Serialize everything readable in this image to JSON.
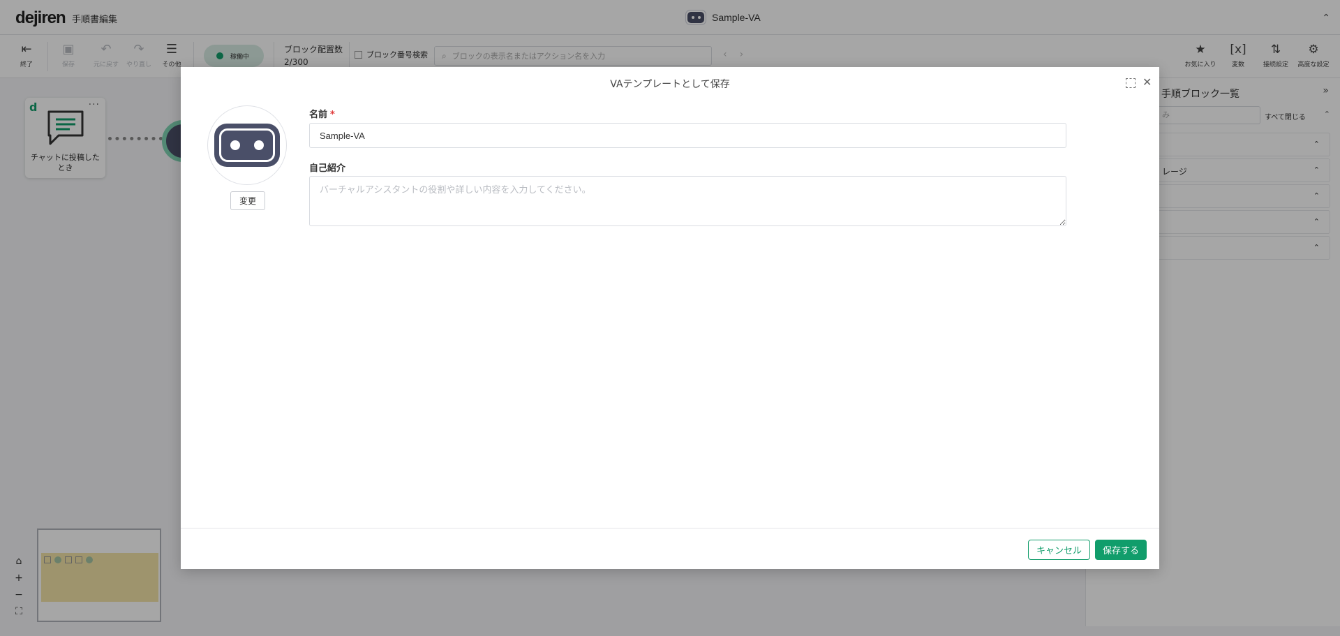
{
  "header": {
    "logo": "dejiren",
    "title": "手順書編集",
    "va_name": "Sample-VA"
  },
  "toolbar": {
    "exit_label": "終了",
    "save_label": "保存",
    "undo_label": "元に戻す",
    "redo_label": "やり直し",
    "other_label": "その他",
    "status_label": "稼働中",
    "block_count_label": "ブロック配置数",
    "block_count_value": "2/300",
    "block_number_search_label": "ブロック番号検索",
    "search_placeholder": "ブロックの表示名またはアクション名を入力",
    "favorites_label": "お気に入り",
    "variables_label": "変数",
    "connection_settings_label": "接続設定",
    "advanced_settings_label": "高度な設定"
  },
  "canvas": {
    "trigger_card_label": "チャットに投稿したとき"
  },
  "right_panel": {
    "title": "手順ブロック一覧",
    "filter_text": "み",
    "close_all_label": "すべて閉じる",
    "rows": [
      {
        "label": ""
      },
      {
        "label": "レージ"
      },
      {
        "label": ""
      },
      {
        "label": ""
      },
      {
        "label": ""
      }
    ]
  },
  "modal": {
    "title": "VAテンプレートとして保存",
    "change_label": "変更",
    "name_label": "名前",
    "required_mark": "*",
    "name_value": "Sample-VA",
    "intro_label": "自己紹介",
    "intro_placeholder": "バーチャルアシスタントの役割や詳しい内容を入力してください。",
    "cancel_label": "キャンセル",
    "save_label": "保存する"
  },
  "colors": {
    "brand_green": "#119d6b",
    "robot_navy": "#4a4f68",
    "required_red": "#e03b3b"
  },
  "icons": {
    "exit": "exit-icon",
    "save": "save-icon",
    "undo": "undo-icon",
    "redo": "redo-icon",
    "other": "menu-icon",
    "search": "search-icon",
    "favorites": "star-icon",
    "variables": "variable-icon",
    "connection": "connection-icon",
    "advanced": "gear-icon",
    "close": "close-icon",
    "select": "select-area-icon"
  }
}
